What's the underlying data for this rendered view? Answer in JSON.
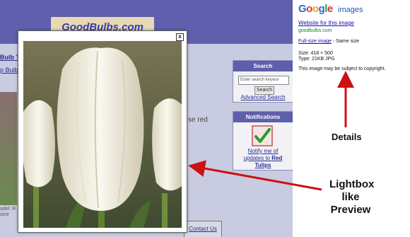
{
  "background_site": {
    "logo": "GoodBulbs.com",
    "crumb1": "Bulb Tu",
    "crumb2": "p Bulbs",
    "body_text": "se red",
    "small_lines": [
      "odel: R",
      "oice",
      ""
    ],
    "search_widget": {
      "title": "Search",
      "placeholder": "Enter search keywor",
      "button": "Search",
      "advanced": "Advanced Search"
    },
    "notify_widget": {
      "title": "Notifications",
      "text_line1": "Notify me of",
      "text_line2": "updates to",
      "text_bold": "Red",
      "text_line3": "Tulips"
    },
    "contact": "Contact Us"
  },
  "lightbox": {
    "close": "x"
  },
  "panel": {
    "logo_letters": [
      "G",
      "o",
      "o",
      "g",
      "l",
      "e"
    ],
    "logo_colors": [
      "#3366cc",
      "#dd3333",
      "#eeaa11",
      "#3366cc",
      "#11aa44",
      "#dd3333"
    ],
    "images_label": "images",
    "website_link": "Website for this image",
    "domain": "goodbulbs.com",
    "fullsize_link": "Full-size image",
    "fullsize_suffix": " - Same size",
    "size": "Size:   418 × 500",
    "type": "Type:   21KB JPG",
    "copyright": "This image may be subject to copyright."
  },
  "annotations": {
    "details": "Details",
    "lightbox_line1": "Lightbox",
    "lightbox_line2": "like",
    "lightbox_line3": "Preview",
    "arrow_color": "#cc1111"
  }
}
